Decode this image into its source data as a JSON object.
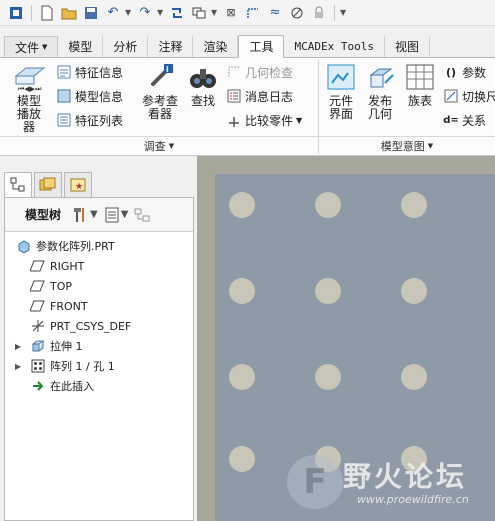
{
  "ribbon_tabs": [
    "文件",
    "模型",
    "分析",
    "注释",
    "渲染",
    "工具",
    "MCADEx Tools",
    "视图"
  ],
  "active_tab": "工具",
  "ribbon": {
    "model_player": "模型播放器",
    "feature_info": "特征信息",
    "model_info": "模型信息",
    "feature_list": "特征列表",
    "reference_viewer": "参考查看器",
    "find": "查找",
    "geometry_check": "几何检查",
    "message_log": "消息日志",
    "compare_parts": "比较零件",
    "investigate_group": "调查",
    "element_interface": "元件界面",
    "publish_geometry": "发布几何",
    "family_table": "族表",
    "parameters": "参数",
    "switch": "切换尺",
    "relations": "关系",
    "model_intent_group": "模型意图"
  },
  "model_tree": {
    "title": "模型树",
    "items": [
      {
        "label": "参数化阵列.PRT",
        "icon": "part-icon"
      },
      {
        "label": "RIGHT",
        "icon": "datum-plane-icon"
      },
      {
        "label": "TOP",
        "icon": "datum-plane-icon"
      },
      {
        "label": "FRONT",
        "icon": "datum-plane-icon"
      },
      {
        "label": "PRT_CSYS_DEF",
        "icon": "csys-icon"
      },
      {
        "label": "拉伸 1",
        "icon": "extrude-icon"
      },
      {
        "label": "阵列 1 / 孔 1",
        "icon": "pattern-icon"
      },
      {
        "label": "在此插入",
        "icon": "insert-here-icon"
      }
    ]
  },
  "watermark": {
    "logo": "F",
    "title": "野火论坛",
    "url": "www.proewildfire.cn"
  }
}
